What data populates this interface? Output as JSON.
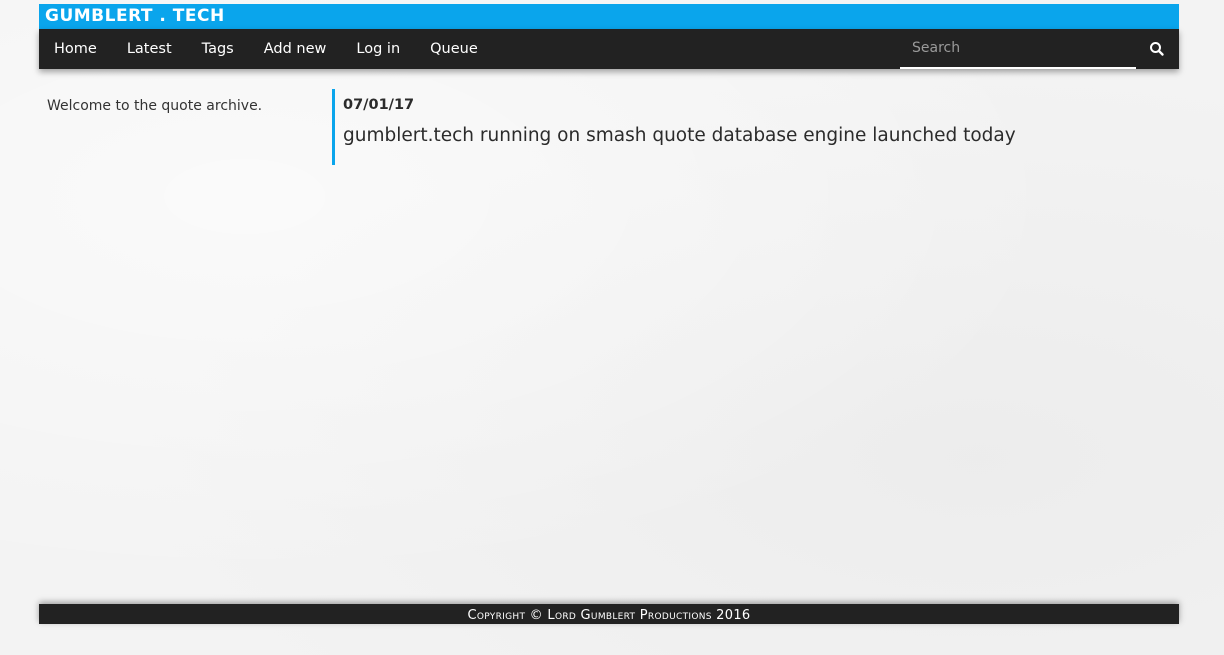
{
  "header": {
    "brand": "GUMBLERT . TECH",
    "accent_color": "#0aa5ec",
    "nav_color": "#222222"
  },
  "nav": {
    "items": [
      {
        "label": "Home"
      },
      {
        "label": "Latest"
      },
      {
        "label": "Tags"
      },
      {
        "label": "Add new"
      },
      {
        "label": "Log in"
      },
      {
        "label": "Queue"
      }
    ],
    "search": {
      "placeholder": "Search",
      "value": "",
      "icon": "search-icon"
    }
  },
  "sidebar": {
    "welcome": "Welcome to the quote archive."
  },
  "news": {
    "date": "07/01/17",
    "text": "gumblert.tech running on smash quote database engine launched today"
  },
  "footer": {
    "copyright": "Copyright © Lord Gumblert Productions 2016"
  }
}
